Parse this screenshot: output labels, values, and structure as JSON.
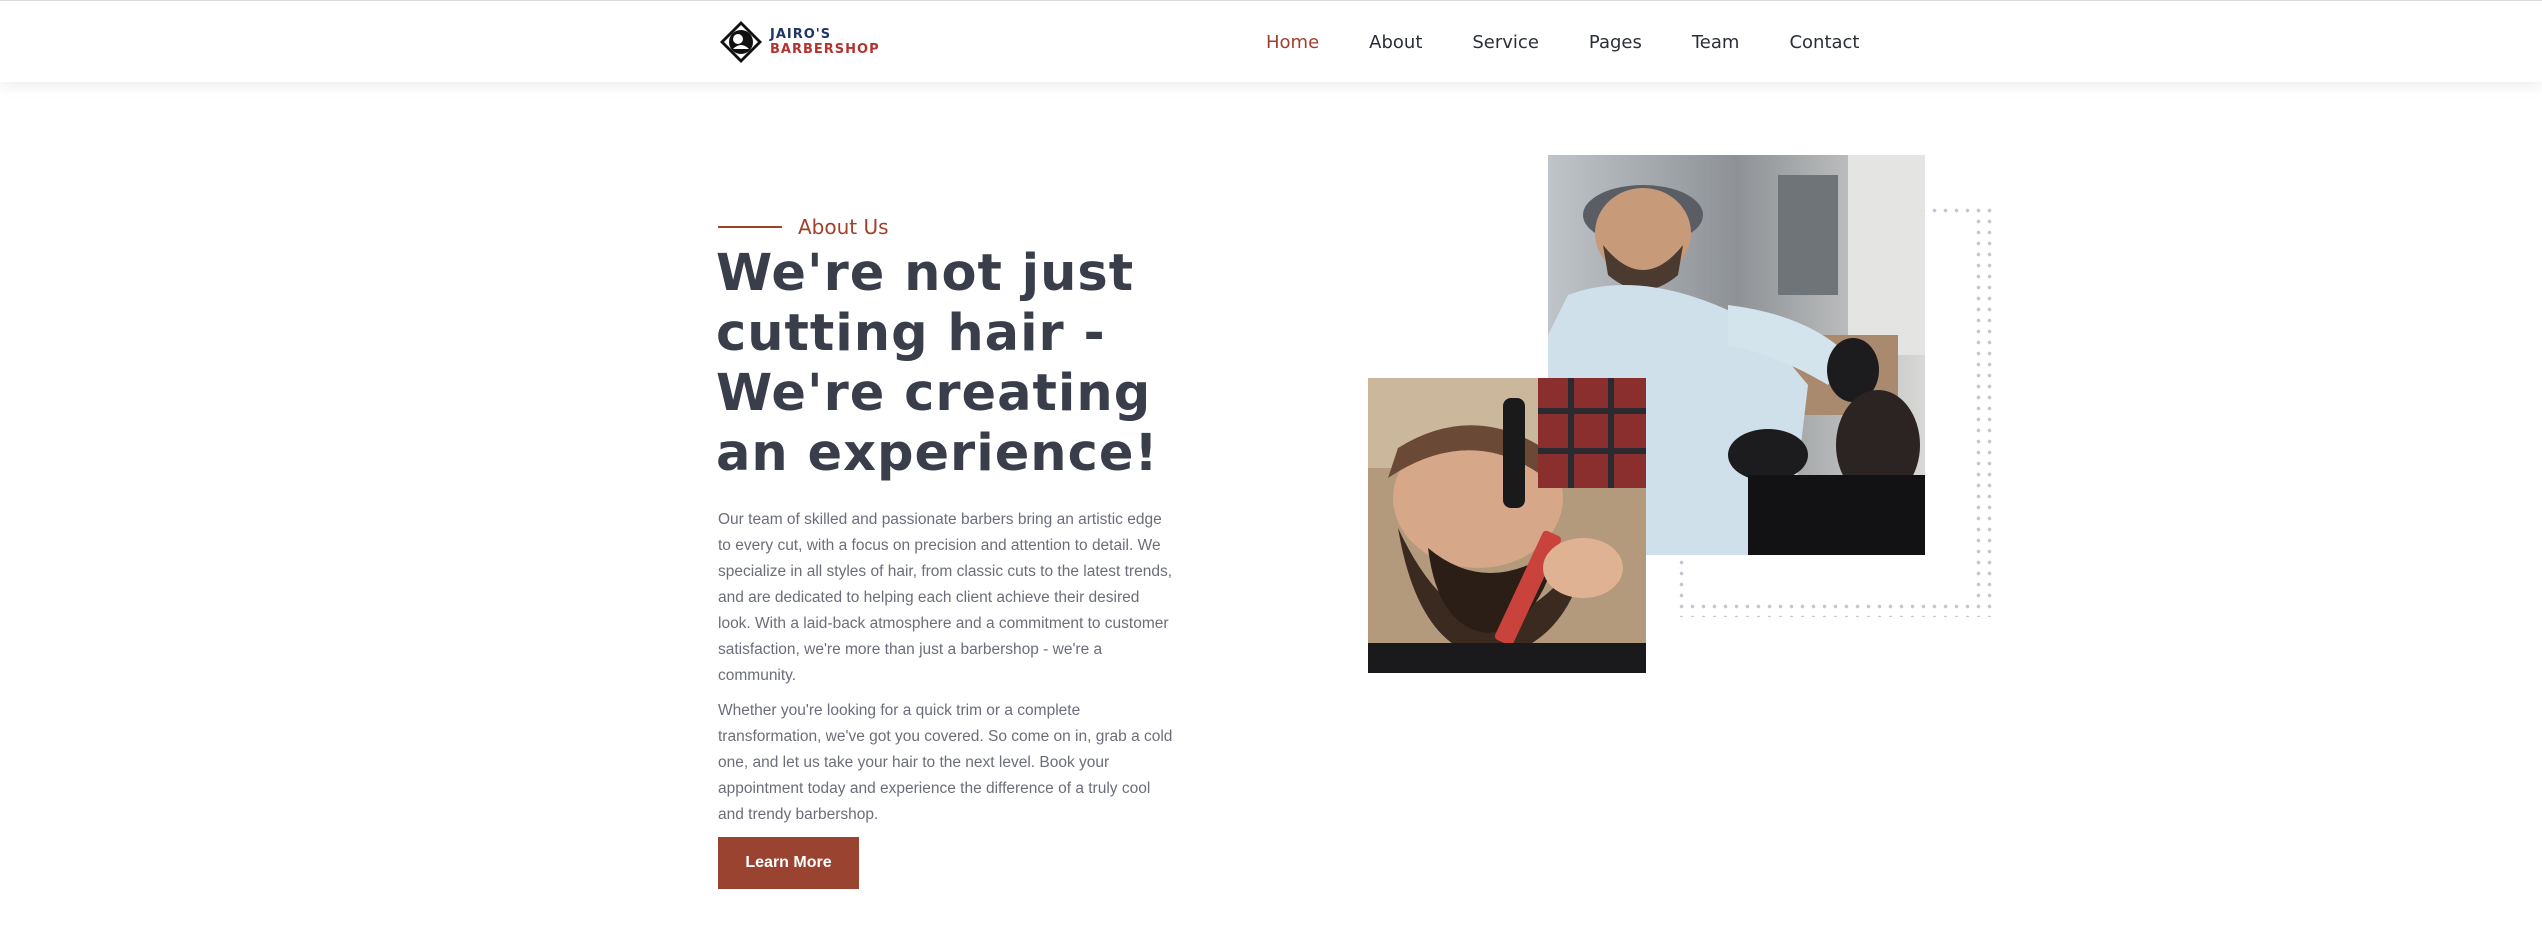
{
  "header": {
    "logo": {
      "line1": "JAIRO'S",
      "line2": "BARBERSHOP"
    },
    "nav": [
      {
        "label": "Home",
        "active": true
      },
      {
        "label": "About",
        "active": false
      },
      {
        "label": "Service",
        "active": false
      },
      {
        "label": "Pages",
        "active": false
      },
      {
        "label": "Team",
        "active": false
      },
      {
        "label": "Contact",
        "active": false
      }
    ]
  },
  "about": {
    "eyebrow": "About Us",
    "headline": "We're not just cutting hair - We're creating an experience!",
    "paragraph1": "Our team of skilled and passionate barbers bring an artistic edge to every cut, with a focus on precision and attention to detail. We specialize in all styles of hair, from classic cuts to the latest trends, and are dedicated to helping each client achieve their desired look. With a laid-back atmosphere and a commitment to customer satisfaction, we're more than just a barbershop - we're a community.",
    "paragraph2": "Whether you're looking for a quick trim or a complete transformation, we've got you covered. So come on in, grab a cold one, and let us take your hair to the next level. Book your appointment today and experience the difference of a truly cool and trendy barbershop.",
    "button_label": "Learn More"
  },
  "colors": {
    "accent": "#a0402c",
    "button": "#9b4331",
    "heading": "#3a3d4a",
    "body_text": "#6b6e7a"
  }
}
